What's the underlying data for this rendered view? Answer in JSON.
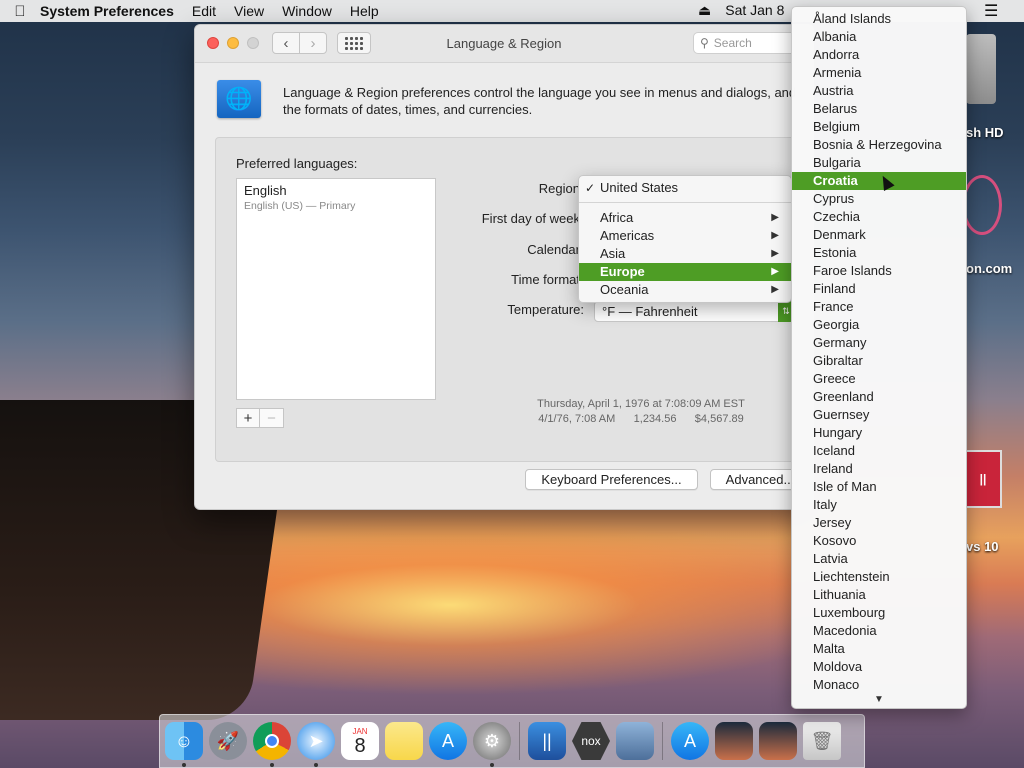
{
  "menubar": {
    "app_name": "System Preferences",
    "items": [
      "Edit",
      "View",
      "Window",
      "Help"
    ],
    "clock": "Sat Jan 8"
  },
  "window": {
    "title": "Language & Region",
    "search_placeholder": "Search",
    "description": "Language & Region preferences control the language you see in menus and dialogs, and the formats of dates, times, and currencies."
  },
  "languages": {
    "label": "Preferred languages:",
    "items": [
      {
        "name": "English",
        "detail": "English (US) — Primary"
      }
    ]
  },
  "fields": {
    "region": "Region",
    "first_day": "First day of week",
    "calendar": "Calendar",
    "time_format": "Time format",
    "temperature": "Temperature:",
    "temperature_value": "°F — Fahrenheit"
  },
  "sample": {
    "line1": "Thursday, April 1, 1976 at 7:08:09 AM EST",
    "line2": "4/1/76, 7:08 AM      1,234.56      $4,567.89"
  },
  "buttons": {
    "keyboard": "Keyboard Preferences...",
    "advanced": "Advanced..."
  },
  "region_menu": {
    "current": "United States",
    "groups": [
      "Africa",
      "Americas",
      "Asia",
      "Europe",
      "Oceania"
    ],
    "selected_group": "Europe"
  },
  "country_menu": {
    "selected": "Croatia",
    "items": [
      "Åland Islands",
      "Albania",
      "Andorra",
      "Armenia",
      "Austria",
      "Belarus",
      "Belgium",
      "Bosnia & Herzegovina",
      "Bulgaria",
      "Croatia",
      "Cyprus",
      "Czechia",
      "Denmark",
      "Estonia",
      "Faroe Islands",
      "Finland",
      "France",
      "Georgia",
      "Germany",
      "Gibraltar",
      "Greece",
      "Greenland",
      "Guernsey",
      "Hungary",
      "Iceland",
      "Ireland",
      "Isle of Man",
      "Italy",
      "Jersey",
      "Kosovo",
      "Latvia",
      "Liechtenstein",
      "Lithuania",
      "Luxembourg",
      "Macedonia",
      "Malta",
      "Moldova",
      "Monaco"
    ]
  },
  "desktop": {
    "icon1": "sh HD",
    "icon2": "on.com",
    "icon3": "vs 10"
  },
  "colors": {
    "accent": "#4e9d25"
  }
}
